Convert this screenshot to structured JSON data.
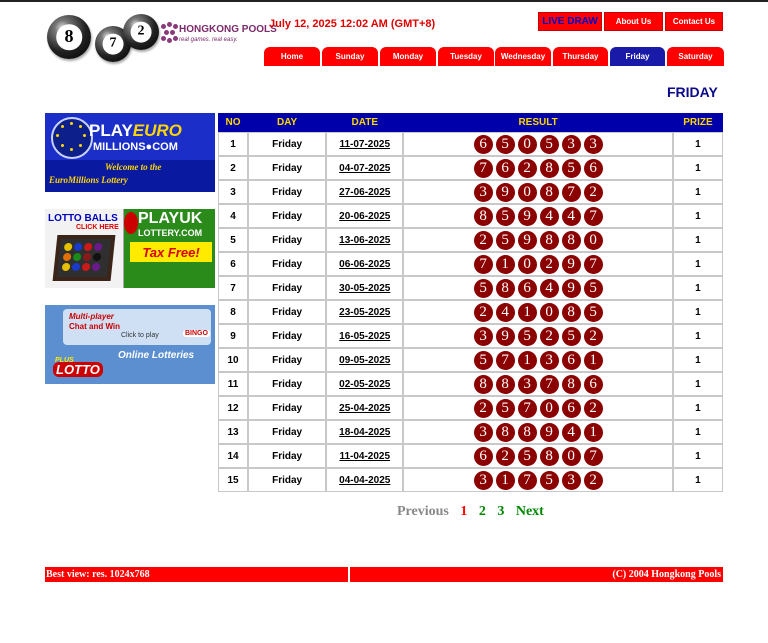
{
  "logo": {
    "balls": [
      "8",
      "7",
      "2"
    ],
    "brand_name": "HONGKONG POOLS",
    "tagline": "real games. real easy."
  },
  "header": {
    "datetime": "July 12, 2025 12:02 AM (GMT+8)",
    "buttons": {
      "live_draw": "LIVE DRAW",
      "about_us": "About Us",
      "contact_us": "Contact Us"
    }
  },
  "tabs": [
    "Home",
    "Sunday",
    "Monday",
    "Tuesday",
    "Wednesday",
    "Thursday",
    "Friday",
    "Saturday"
  ],
  "active_tab": "Friday",
  "page_heading": "FRIDAY",
  "banners": {
    "euro": {
      "brand_play": "PLAY",
      "brand_euro": "EURO",
      "site": "MILLIONS●COM",
      "welcome_line1": "Welcome to the",
      "welcome_line2": "EuroMillions Lottery"
    },
    "uk": {
      "lotto_balls": "LOTTO BALLS",
      "click_here": "CLICK HERE",
      "brand": "PLAYUK",
      "site": "LOTTERY.COM",
      "tax_free": "Tax Free!"
    },
    "online": {
      "multi_player": "Multi-player",
      "chat_win": "Chat and Win",
      "click_to_play": "Click to play",
      "bingo": "BINGO",
      "online_lotteries": "Online Lotteries",
      "plus": "PLUS",
      "lotto": "LOTTO"
    }
  },
  "table": {
    "headers": {
      "no": "NO",
      "day": "DAY",
      "date": "DATE",
      "result": "RESULT",
      "prize": "PRIZE"
    },
    "rows": [
      {
        "no": "1",
        "day": "Friday",
        "date": "11-07-2025",
        "result": [
          "6",
          "5",
          "0",
          "5",
          "3",
          "3"
        ],
        "prize": "1"
      },
      {
        "no": "2",
        "day": "Friday",
        "date": "04-07-2025",
        "result": [
          "7",
          "6",
          "2",
          "8",
          "5",
          "6"
        ],
        "prize": "1"
      },
      {
        "no": "3",
        "day": "Friday",
        "date": "27-06-2025",
        "result": [
          "3",
          "9",
          "0",
          "8",
          "7",
          "2"
        ],
        "prize": "1"
      },
      {
        "no": "4",
        "day": "Friday",
        "date": "20-06-2025",
        "result": [
          "8",
          "5",
          "9",
          "4",
          "4",
          "7"
        ],
        "prize": "1"
      },
      {
        "no": "5",
        "day": "Friday",
        "date": "13-06-2025",
        "result": [
          "2",
          "5",
          "9",
          "8",
          "8",
          "0"
        ],
        "prize": "1"
      },
      {
        "no": "6",
        "day": "Friday",
        "date": "06-06-2025",
        "result": [
          "7",
          "1",
          "0",
          "2",
          "9",
          "7"
        ],
        "prize": "1"
      },
      {
        "no": "7",
        "day": "Friday",
        "date": "30-05-2025",
        "result": [
          "5",
          "8",
          "6",
          "4",
          "9",
          "5"
        ],
        "prize": "1"
      },
      {
        "no": "8",
        "day": "Friday",
        "date": "23-05-2025",
        "result": [
          "2",
          "4",
          "1",
          "0",
          "8",
          "5"
        ],
        "prize": "1"
      },
      {
        "no": "9",
        "day": "Friday",
        "date": "16-05-2025",
        "result": [
          "3",
          "9",
          "5",
          "2",
          "5",
          "2"
        ],
        "prize": "1"
      },
      {
        "no": "10",
        "day": "Friday",
        "date": "09-05-2025",
        "result": [
          "5",
          "7",
          "1",
          "3",
          "6",
          "1"
        ],
        "prize": "1"
      },
      {
        "no": "11",
        "day": "Friday",
        "date": "02-05-2025",
        "result": [
          "8",
          "8",
          "3",
          "7",
          "8",
          "6"
        ],
        "prize": "1"
      },
      {
        "no": "12",
        "day": "Friday",
        "date": "25-04-2025",
        "result": [
          "2",
          "5",
          "7",
          "0",
          "6",
          "2"
        ],
        "prize": "1"
      },
      {
        "no": "13",
        "day": "Friday",
        "date": "18-04-2025",
        "result": [
          "3",
          "8",
          "8",
          "9",
          "4",
          "1"
        ],
        "prize": "1"
      },
      {
        "no": "14",
        "day": "Friday",
        "date": "11-04-2025",
        "result": [
          "6",
          "2",
          "5",
          "8",
          "0",
          "7"
        ],
        "prize": "1"
      },
      {
        "no": "15",
        "day": "Friday",
        "date": "04-04-2025",
        "result": [
          "3",
          "1",
          "7",
          "5",
          "3",
          "2"
        ],
        "prize": "1"
      }
    ]
  },
  "pagination": {
    "previous": "Previous",
    "pages": [
      "1",
      "2",
      "3"
    ],
    "current": "1",
    "next": "Next"
  },
  "footer": {
    "left": "Best view: res. 1024x768",
    "right": "(C) 2004 Hongkong Pools"
  },
  "colors": {
    "red": "#ff0000",
    "navy_header": "#0000aa",
    "active_tab": "#1a1aa8",
    "result_ball": "#8b0000",
    "heading": "#0a0a8a"
  }
}
